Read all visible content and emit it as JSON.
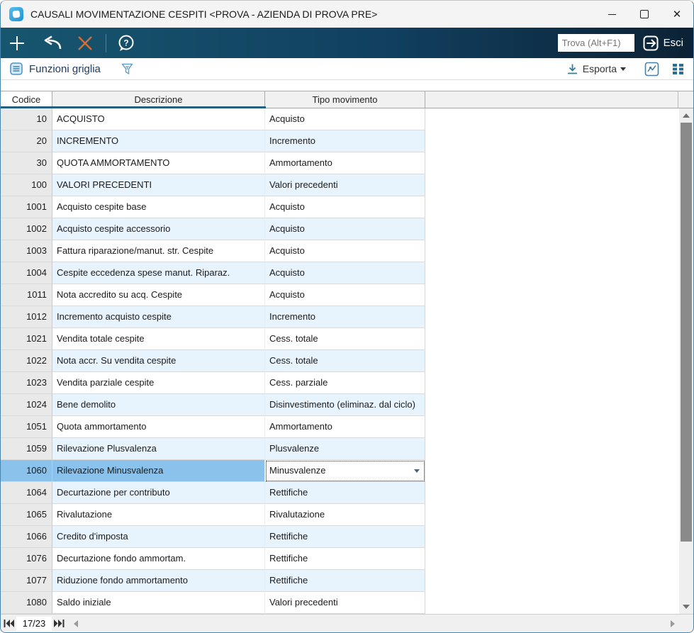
{
  "window": {
    "title": "CAUSALI MOVIMENTAZIONE CESPITI <PROVA - AZIENDA DI PROVA PRE>"
  },
  "toolbar": {
    "find_placeholder": "Trova (Alt+F1)",
    "exit_label": "Esci"
  },
  "funcbar": {
    "functions_label": "Funzioni griglia",
    "export_label": "Esporta"
  },
  "table": {
    "columns": [
      "Codice",
      "Descrizione",
      "Tipo movimento"
    ],
    "selected_index": 16,
    "rows": [
      {
        "code": "10",
        "desc": "ACQUISTO",
        "type": "Acquisto"
      },
      {
        "code": "20",
        "desc": "INCREMENTO",
        "type": "Incremento"
      },
      {
        "code": "30",
        "desc": "QUOTA AMMORTAMENTO",
        "type": "Ammortamento"
      },
      {
        "code": "100",
        "desc": "VALORI PRECEDENTI",
        "type": "Valori precedenti"
      },
      {
        "code": "1001",
        "desc": "Acquisto cespite base",
        "type": "Acquisto"
      },
      {
        "code": "1002",
        "desc": "Acquisto cespite accessorio",
        "type": "Acquisto"
      },
      {
        "code": "1003",
        "desc": "Fattura riparazione/manut. str. Cespite",
        "type": "Acquisto"
      },
      {
        "code": "1004",
        "desc": "Cespite eccedenza spese manut. Riparaz.",
        "type": "Acquisto"
      },
      {
        "code": "1011",
        "desc": "Nota accredito su acq. Cespite",
        "type": "Acquisto"
      },
      {
        "code": "1012",
        "desc": "Incremento acquisto cespite",
        "type": "Incremento"
      },
      {
        "code": "1021",
        "desc": "Vendita totale cespite",
        "type": "Cess. totale"
      },
      {
        "code": "1022",
        "desc": "Nota accr. Su vendita cespite",
        "type": "Cess. totale"
      },
      {
        "code": "1023",
        "desc": "Vendita parziale cespite",
        "type": "Cess. parziale"
      },
      {
        "code": "1024",
        "desc": "Bene demolito",
        "type": "Disinvestimento (eliminaz. dal ciclo)"
      },
      {
        "code": "1051",
        "desc": "Quota ammortamento",
        "type": "Ammortamento"
      },
      {
        "code": "1059",
        "desc": "Rilevazione Plusvalenza",
        "type": "Plusvalenze"
      },
      {
        "code": "1060",
        "desc": "Rilevazione Minusvalenza",
        "type": "Minusvalenze"
      },
      {
        "code": "1064",
        "desc": "Decurtazione per contributo",
        "type": "Rettifiche"
      },
      {
        "code": "1065",
        "desc": "Rivalutazione",
        "type": "Rivalutazione"
      },
      {
        "code": "1066",
        "desc": "Credito d'imposta",
        "type": "Rettifiche"
      },
      {
        "code": "1076",
        "desc": "Decurtazione fondo ammortam.",
        "type": "Rettifiche"
      },
      {
        "code": "1077",
        "desc": "Riduzione fondo ammortamento",
        "type": "Rettifiche"
      },
      {
        "code": "1080",
        "desc": "Saldo iniziale",
        "type": "Valori precedenti"
      }
    ]
  },
  "statusbar": {
    "record_counter": "17/23"
  },
  "icons": [
    "app-logo-icon",
    "minimize-icon",
    "maximize-icon",
    "close-window-icon",
    "add-icon",
    "undo-icon",
    "delete-x-icon",
    "help-icon",
    "exit-icon",
    "grid-functions-icon",
    "filter-funnel-icon",
    "download-icon",
    "caret-down-icon",
    "line-chart-icon",
    "grid-view-icon",
    "first-record-icon",
    "last-record-icon",
    "scroll-arrow-icons"
  ],
  "colors": {
    "toolbar_gradient_start": "#17566f",
    "toolbar_gradient_end": "#0c2235",
    "selection_blue": "#8ac2ec",
    "row_alt_blue": "#e8f4fd",
    "header_underline": "#23617f",
    "delete_x_orange": "#d46e38",
    "icon_teal": "#2e7fa3"
  }
}
